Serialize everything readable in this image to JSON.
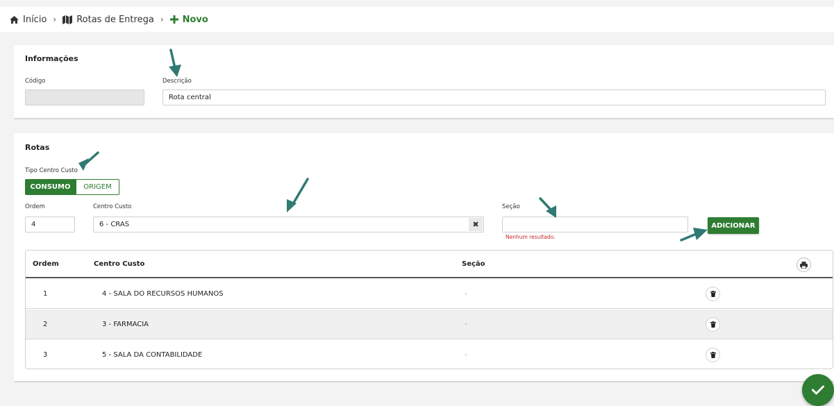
{
  "breadcrumb": {
    "home": "Início",
    "routes": "Rotas de Entrega",
    "new": "Novo"
  },
  "info": {
    "title": "Informações",
    "code_label": "Código",
    "code_value": "",
    "description_label": "Descrição",
    "description_value": "Rota central"
  },
  "rotas": {
    "title": "Rotas",
    "type_label": "Tipo Centro Custo",
    "type_options": [
      "CONSUMO",
      "ORIGEM"
    ],
    "type_selected": "CONSUMO",
    "order_label": "Ordem",
    "order_value": "4",
    "cost_center_label": "Centro Custo",
    "cost_center_value": "6 - CRAS",
    "section_label": "Seção",
    "section_value": "",
    "section_error": "Nenhum resultado.",
    "add_button": "ADICIONAR"
  },
  "table": {
    "headers": [
      "Ordem",
      "Centro Custo",
      "Seção"
    ],
    "rows": [
      {
        "order": "1",
        "cost_center": "4 - SALA DO RECURSOS HUMANOS",
        "section": "-"
      },
      {
        "order": "2",
        "cost_center": "3 - FARMACIA",
        "section": "-"
      },
      {
        "order": "3",
        "cost_center": "5 - SALA DA CONTABILIDADE",
        "section": "-"
      }
    ]
  },
  "icons": {
    "home": "home-icon",
    "map": "map-icon",
    "plus": "plus-icon",
    "clear": "clear-x-icon",
    "trash": "trash-icon",
    "print": "print-icon",
    "confirm": "check-icon"
  },
  "colors": {
    "primary": "#2e7d32",
    "error": "#c62828",
    "annotation_arrow": "#2f7a72"
  }
}
